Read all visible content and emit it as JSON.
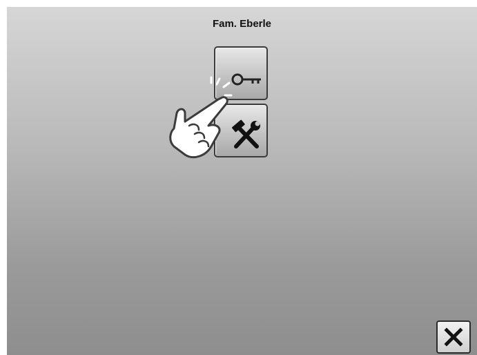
{
  "header": {
    "title": "Fam. Eberle"
  },
  "tiles": [
    {
      "icon": "key-icon"
    },
    {
      "icon": "tools-icon"
    }
  ],
  "footer": {
    "close_icon": "close-icon"
  },
  "overlay": {
    "icon": "tapping-hand-icon"
  },
  "colors": {
    "background_top": "#d6d6d6",
    "background_bottom": "#8e8e8e",
    "tile_border": "#3a3a3a",
    "text": "#111111"
  }
}
